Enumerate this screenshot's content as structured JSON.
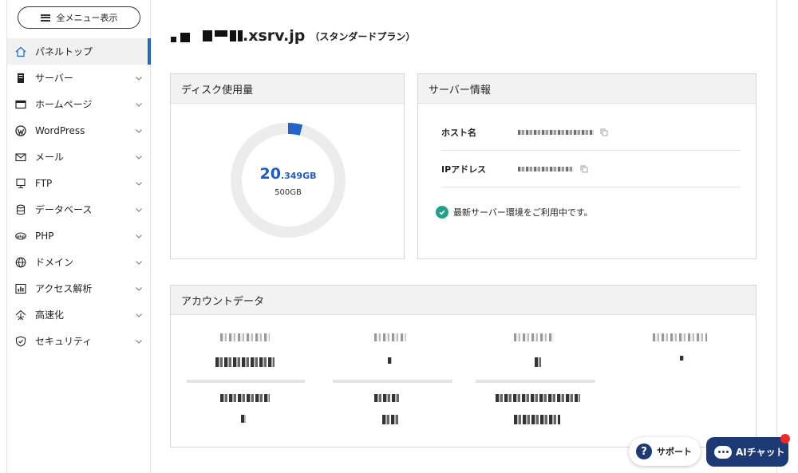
{
  "sidebar": {
    "menu_button": "全メニュー表示",
    "items": [
      {
        "label": "パネルトップ",
        "icon": "home-icon",
        "active": true
      },
      {
        "label": "サーバー",
        "icon": "server-icon"
      },
      {
        "label": "ホームページ",
        "icon": "browser-window-icon"
      },
      {
        "label": "WordPress",
        "icon": "wordpress-icon"
      },
      {
        "label": "メール",
        "icon": "mail-icon"
      },
      {
        "label": "FTP",
        "icon": "monitor-icon"
      },
      {
        "label": "データベース",
        "icon": "database-icon"
      },
      {
        "label": "PHP",
        "icon": "php-icon"
      },
      {
        "label": "ドメイン",
        "icon": "globe-icon"
      },
      {
        "label": "アクセス解析",
        "icon": "chart-icon"
      },
      {
        "label": "高速化",
        "icon": "network-icon"
      },
      {
        "label": "セキュリティ",
        "icon": "shield-icon"
      }
    ]
  },
  "header": {
    "domain_suffix": ".xsrv.jp",
    "plan": "（スタンダードプラン）"
  },
  "disk": {
    "title": "ディスク使用量",
    "used_int": "20",
    "used_dec": ".349GB",
    "total": "500GB",
    "used_fraction": 0.0407
  },
  "server_info": {
    "title": "サーバー情報",
    "host_label": "ホスト名",
    "ip_label": "IPアドレス",
    "status": "最新サーバー環境をご利用中です。"
  },
  "account": {
    "title": "アカウントデータ"
  },
  "support": {
    "label": "サポート",
    "icon": "?"
  },
  "ai_chat": {
    "label": "AIチャット"
  },
  "colors": {
    "accent": "#2563c9",
    "navy": "#1d3a76",
    "ok": "#23a08a",
    "notify": "#f02a2a"
  }
}
